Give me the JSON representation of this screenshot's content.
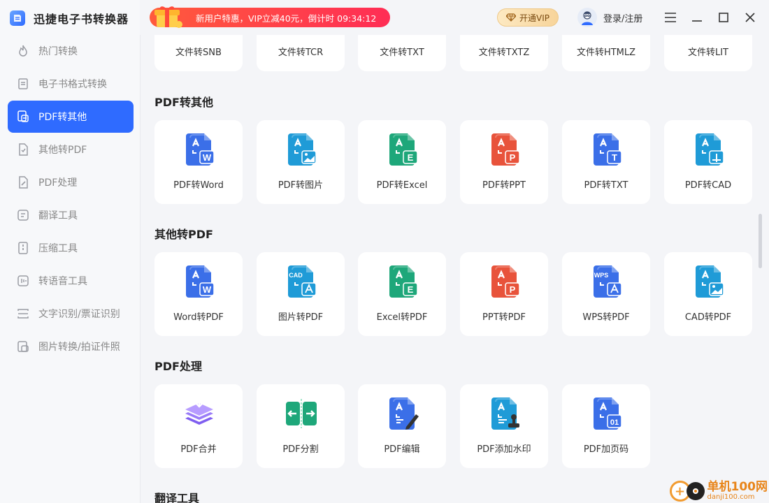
{
  "app": {
    "title": "迅捷电子书转换器"
  },
  "promo": {
    "text": "新用户特惠，VIP立减40元，倒计时 09:34:12"
  },
  "vip": {
    "label": "开通VIP"
  },
  "user": {
    "label": "登录/注册"
  },
  "sidebar": {
    "items": [
      {
        "label": "热门转换",
        "icon": "fire-icon"
      },
      {
        "label": "电子书格式转换",
        "icon": "book-icon"
      },
      {
        "label": "PDF转其他",
        "icon": "pdf-convert-icon",
        "active": true
      },
      {
        "label": "其他转PDF",
        "icon": "to-pdf-icon"
      },
      {
        "label": "PDF处理",
        "icon": "pdf-edit-icon"
      },
      {
        "label": "翻译工具",
        "icon": "translate-icon"
      },
      {
        "label": "压缩工具",
        "icon": "compress-icon"
      },
      {
        "label": "转语音工具",
        "icon": "voice-icon"
      },
      {
        "label": "文字识别/票证识别",
        "icon": "ocr-icon"
      },
      {
        "label": "图片转换/拍证件照",
        "icon": "photo-icon"
      }
    ]
  },
  "top_row": {
    "items": [
      "文件转SNB",
      "文件转TCR",
      "文件转TXT",
      "文件转TXTZ",
      "文件转HTMLZ",
      "文件转LIT"
    ]
  },
  "sections": [
    {
      "title": "PDF转其他",
      "items": [
        {
          "label": "PDF转Word",
          "icon": "pdf-to-word-icon",
          "color": "#3b6fe8",
          "badge": "W"
        },
        {
          "label": "PDF转图片",
          "icon": "pdf-to-image-icon",
          "color": "#1f9bd7",
          "badge": "img"
        },
        {
          "label": "PDF转Excel",
          "icon": "pdf-to-excel-icon",
          "color": "#1ea77a",
          "badge": "E"
        },
        {
          "label": "PDF转PPT",
          "icon": "pdf-to-ppt-icon",
          "color": "#e8533b",
          "badge": "P"
        },
        {
          "label": "PDF转TXT",
          "icon": "pdf-to-txt-icon",
          "color": "#3b6fe8",
          "badge": "T"
        },
        {
          "label": "PDF转CAD",
          "icon": "pdf-to-cad-icon",
          "color": "#1f9bd7",
          "badge": "cad"
        }
      ]
    },
    {
      "title": "其他转PDF",
      "items": [
        {
          "label": "Word转PDF",
          "icon": "word-to-pdf-icon",
          "color": "#3b6fe8",
          "badge": "W"
        },
        {
          "label": "图片转PDF",
          "icon": "image-to-pdf-icon",
          "color": "#1f9bd7",
          "badge": "CAD"
        },
        {
          "label": "Excel转PDF",
          "icon": "excel-to-pdf-icon",
          "color": "#1ea77a",
          "badge": "E"
        },
        {
          "label": "PPT转PDF",
          "icon": "ppt-to-pdf-icon",
          "color": "#e8533b",
          "badge": "P"
        },
        {
          "label": "WPS转PDF",
          "icon": "wps-to-pdf-icon",
          "color": "#3b6fe8",
          "badge": "WPS"
        },
        {
          "label": "CAD转PDF",
          "icon": "cad-to-pdf-icon",
          "color": "#1f9bd7",
          "badge": "img"
        }
      ]
    },
    {
      "title": "PDF处理",
      "items": [
        {
          "label": "PDF合并",
          "icon": "pdf-merge-icon",
          "color": "#8a5cf5",
          "badge": "merge"
        },
        {
          "label": "PDF分割",
          "icon": "pdf-split-icon",
          "color": "#1ea77a",
          "badge": "split"
        },
        {
          "label": "PDF编辑",
          "icon": "pdf-edit-icon",
          "color": "#3b6fe8",
          "badge": "edit"
        },
        {
          "label": "PDF添加水印",
          "icon": "pdf-watermark-icon",
          "color": "#1f9bd7",
          "badge": "stamp"
        },
        {
          "label": "PDF加页码",
          "icon": "pdf-page-number-icon",
          "color": "#3b6fe8",
          "badge": "01"
        }
      ]
    },
    {
      "title": "翻译工具",
      "items": []
    }
  ],
  "watermark": {
    "title": "单机100网",
    "url": "danji100.com"
  },
  "colors": {
    "accent": "#2f6bff",
    "promo": "#ff3b4e"
  }
}
